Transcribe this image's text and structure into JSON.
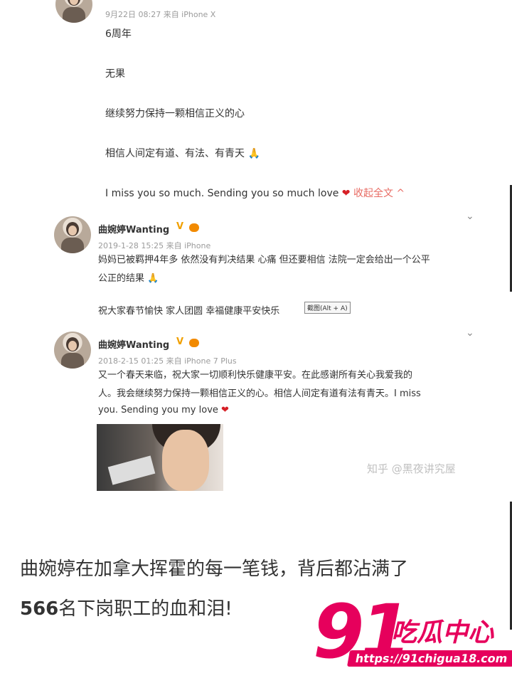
{
  "post_top": {
    "meta": "9月22日 08:27 来自 iPhone X",
    "lines": [
      "6周年",
      "无果",
      "继续努力保持一颗相信正义的心",
      "相信人间定有道、有法、有青天 🙏",
      "I miss you so much. Sending you so much love"
    ],
    "collapse": "收起全文 ^"
  },
  "post2": {
    "name": "曲婉婷Wanting",
    "v": "V",
    "meta": "2019-1-28 15:25 来自 iPhone",
    "line1": "妈妈已被羁押4年多 依然没有判决结果 心痛 但还要相信 法院一定会给出一个公平",
    "line2": "公正的结果 🙏",
    "line3": "祝大家春节愉快 家人团圆 幸福健康平安快乐",
    "tooltip": "截图(Alt + A)",
    "chevron": "⌄"
  },
  "post3": {
    "name": "曲婉婷Wanting",
    "v": "V",
    "meta": "2018-2-15 01:25 来自 iPhone 7 Plus",
    "line1": "又一个春天来临，祝大家一切顺利快乐健康平安。在此感谢所有关心我爱我的",
    "line2": "人。我会继续努力保持一颗相信正义的心。相信人间定有道有法有青天。I miss",
    "line3": "you. Sending you my love",
    "chevron": "⌄"
  },
  "watermark": "知乎 @黑夜讲究屋",
  "article": {
    "line1": "曲婉婷在加拿大挥霍的每一笔钱，背后都沾满了",
    "num": "566",
    "line2": "名下岗职工的血和泪!"
  },
  "logo": {
    "num": "91",
    "cn": "吃瓜中心",
    "url": "https://91chigua18.com"
  },
  "colors": {
    "accent": "#e6005c",
    "link": "#e86b63"
  }
}
